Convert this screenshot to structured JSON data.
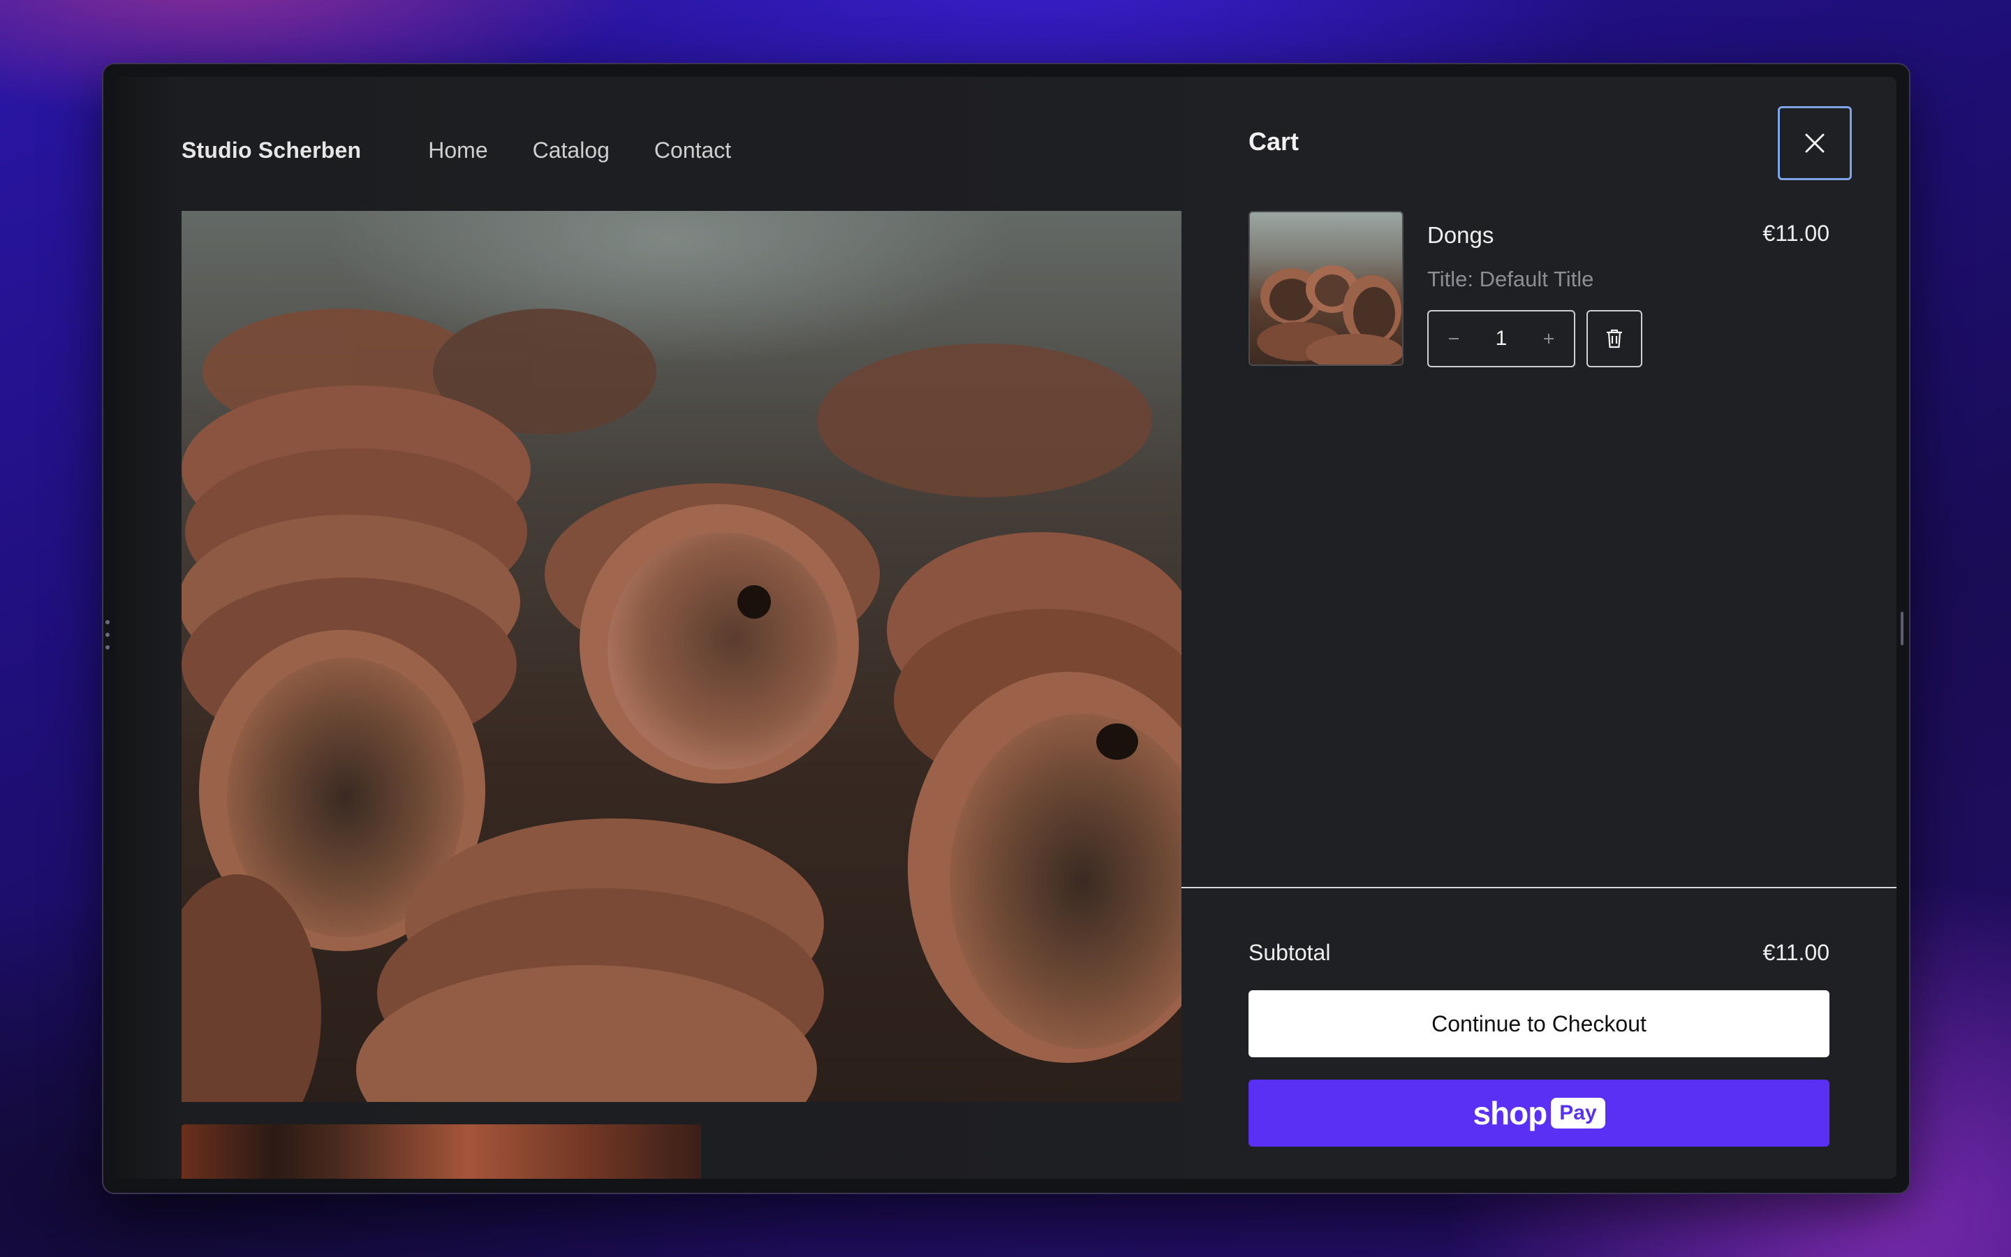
{
  "shop": {
    "brand": "Studio Scherben",
    "nav": [
      {
        "label": "Home"
      },
      {
        "label": "Catalog"
      },
      {
        "label": "Contact"
      }
    ]
  },
  "cart": {
    "title": "Cart",
    "items": [
      {
        "name": "Dongs",
        "price": "€11.00",
        "variant": "Title: Default Title",
        "quantity": "1"
      }
    ],
    "subtotal_label": "Subtotal",
    "subtotal_value": "€11.00",
    "checkout_label": "Continue to Checkout",
    "shoppay": {
      "shop": "shop",
      "pay": "Pay"
    },
    "icons": {
      "close": "close-icon",
      "remove": "trash-icon",
      "minus": "minus-icon",
      "plus": "plus-icon"
    }
  },
  "colors": {
    "shoppay": "#5a31f4",
    "panel": "#1f2024",
    "focus_ring": "#7fa4e8"
  }
}
